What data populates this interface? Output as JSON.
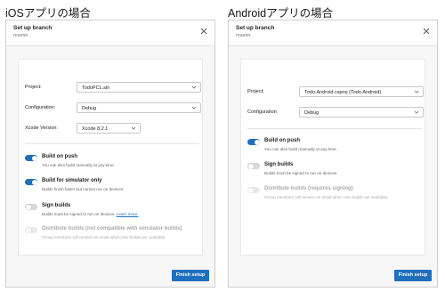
{
  "ios": {
    "caption": "iOSアプリの場合",
    "title": "Set up branch",
    "subtitle": "master",
    "project_label": "Project:",
    "project_value": "TodoPCL.sln",
    "config_label": "Configuration:",
    "config_value": "Debug",
    "xcode_label": "Xcode Version:",
    "xcode_value": "Xcode 8.2.1",
    "build_on_push": {
      "title": "Build on push",
      "desc": "You can also build manually at any time."
    },
    "build_sim": {
      "title": "Build for simulator only",
      "desc": "Builds finish faster but cannot run on devices."
    },
    "sign": {
      "title": "Sign builds",
      "desc": "Builds must be signed to run on devices.",
      "link": "Learn more."
    },
    "distribute": {
      "title": "Distribute builds (not compatible with simulator builds)",
      "desc": "Group members will receive an email when new builds are available."
    },
    "finish": "Finish setup"
  },
  "android": {
    "caption": "Androidアプリの場合",
    "title": "Set up branch",
    "subtitle": "master",
    "project_label": "Project:",
    "project_value": "Todo.Android.csproj (Todo.Android)",
    "config_label": "Configuration:",
    "config_value": "Debug",
    "build_on_push": {
      "title": "Build on push",
      "desc": "You can also build manually at any time."
    },
    "sign": {
      "title": "Sign builds",
      "desc": "Builds must be signed to run on devices."
    },
    "distribute": {
      "title": "Distribute builds (requires signing)",
      "desc": "Group members will receive an email when new builds are available."
    },
    "finish": "Finish setup"
  },
  "colors": {
    "accent": "#1f6fbf",
    "toggle_off": "#d8d8d8"
  }
}
